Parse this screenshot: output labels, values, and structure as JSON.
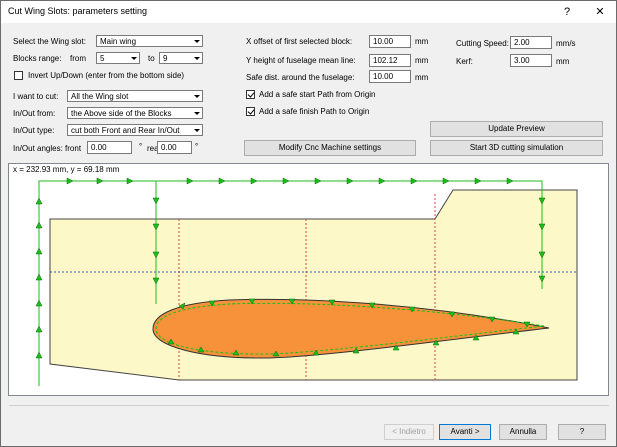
{
  "window": {
    "title": "Cut Wing Slots: parameters setting",
    "help_glyph": "?",
    "close_glyph": "✕"
  },
  "left": {
    "wing_slot_label": "Select the Wing slot:",
    "wing_slot_value": "Main wing",
    "blocks_range_label": "Blocks range:",
    "from_label": "from",
    "from_value": "5",
    "to_label": "to",
    "to_value": "9",
    "invert_label": "Invert Up/Down (enter from the bottom side)",
    "invert_checked": false,
    "want_cut_label": "I want to cut:",
    "want_cut_value": "All the Wing slot",
    "inout_from_label": "In/Out from:",
    "inout_from_value": "the Above side of the Blocks",
    "inout_type_label": "In/Out type:",
    "inout_type_value": "cut both Front and Rear In/Out",
    "angles_label": "In/Out angles:  front",
    "front_value": "0.00",
    "deg1": "°",
    "rear_label": "rear",
    "rear_value": "0.00",
    "deg2": "°"
  },
  "middle": {
    "x_offset_label": "X offset of first selected block:",
    "x_offset_value": "10.00",
    "x_offset_unit": "mm",
    "y_height_label": "Y height of fuselage mean line:",
    "y_height_value": "102.12",
    "y_height_unit": "mm",
    "safe_dist_label": "Safe dist. around the fuselage:",
    "safe_dist_value": "10.00",
    "safe_dist_unit": "mm",
    "safe_start_label": "Add a safe start Path from Origin",
    "safe_start_checked": true,
    "safe_finish_label": "Add a safe finish Path to Origin",
    "safe_finish_checked": true,
    "modify_cnc_button": "Modify Cnc Machine settings"
  },
  "right": {
    "cutting_speed_label": "Cutting Speed:",
    "cutting_speed_value": "2.00",
    "cutting_speed_unit": "mm/s",
    "kerf_label": "Kerf:",
    "kerf_value": "3.00",
    "kerf_unit": "mm",
    "update_preview_button": "Update Preview",
    "start_3d_button": "Start 3D cutting simulation"
  },
  "preview": {
    "coord_readout": "x = 232.93 mm, y = 69.18 mm"
  },
  "footer": {
    "back_button": "< Indietro",
    "next_button": "Avanti >",
    "cancel_button": "Annulla",
    "help_button": "?"
  },
  "colors": {
    "block_fill": "#fdf8c8",
    "airfoil_fill": "#f7923a",
    "path_green": "#1bbf1b",
    "cut_line_red": "#e04040",
    "mean_line_blue": "#3050d0"
  }
}
